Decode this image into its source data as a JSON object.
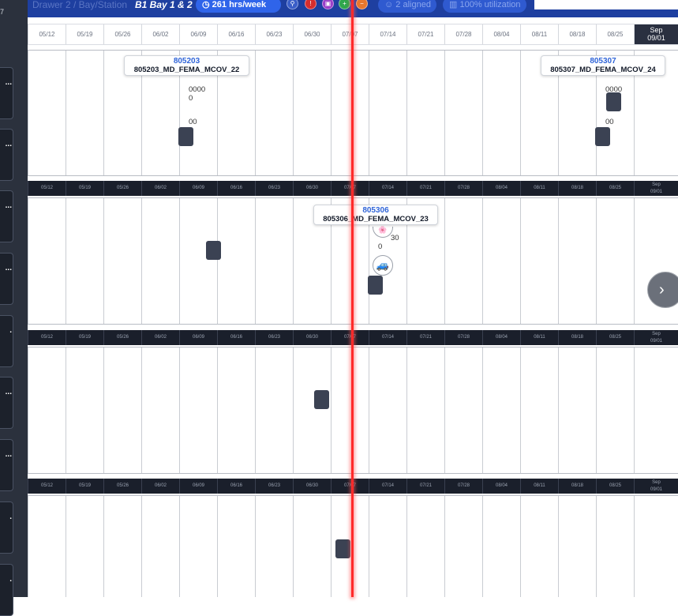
{
  "sidebar": {
    "top_char": "7",
    "items": [
      {
        "dots": "..."
      },
      {
        "dots": "..."
      },
      {
        "dots": "..."
      },
      {
        "dots": "..."
      },
      {
        "dots": "."
      },
      {
        "dots": "..."
      },
      {
        "dots": "..."
      },
      {
        "dots": "."
      },
      {
        "dots": "."
      }
    ]
  },
  "topbar": {
    "faded_left": "Drawer 2 / Bay/Station",
    "bay": "B1 Bay 1 & 2",
    "hours_icon": "clock-icon",
    "hours": "261 hrs/week",
    "status_circles": [
      "link-icon",
      "alert-icon",
      "lock-icon",
      "plus-icon",
      "minus-icon"
    ],
    "aligned": "2 aligned",
    "utilization": "100% utilization"
  },
  "timeline": {
    "weeks": [
      "05/12",
      "05/19",
      "05/26",
      "06/02",
      "06/09",
      "06/16",
      "06/23",
      "06/30",
      "07/07",
      "07/14",
      "07/21",
      "07/28",
      "08/04",
      "08/11",
      "08/18",
      "08/25"
    ],
    "sep_month": "Sep",
    "sep_day": "09/01"
  },
  "rows": [
    {
      "cards": [
        {
          "id": "805203",
          "name": "805203_MD_FEMA_MCOV_22"
        },
        {
          "id": "805307",
          "name": "805307_MD_FEMA_MCOV_24"
        }
      ],
      "labels": [
        "0000",
        "0",
        "00",
        "0000",
        "00"
      ]
    },
    {
      "cards": [
        {
          "id": "805306",
          "name": "805306_MD_FEMA_MCOV_23"
        }
      ],
      "labels": [
        "30",
        "0"
      ],
      "icons": [
        "flower-icon",
        "car-icon"
      ]
    },
    {},
    {}
  ],
  "icons": {
    "flower": "🌸",
    "car": "🚙",
    "chevron_right": "›"
  },
  "colors": {
    "accent": "#2f64ea",
    "today_line": "#ff2a2a",
    "block": "#3b4253",
    "sidebar": "#2b313d"
  }
}
